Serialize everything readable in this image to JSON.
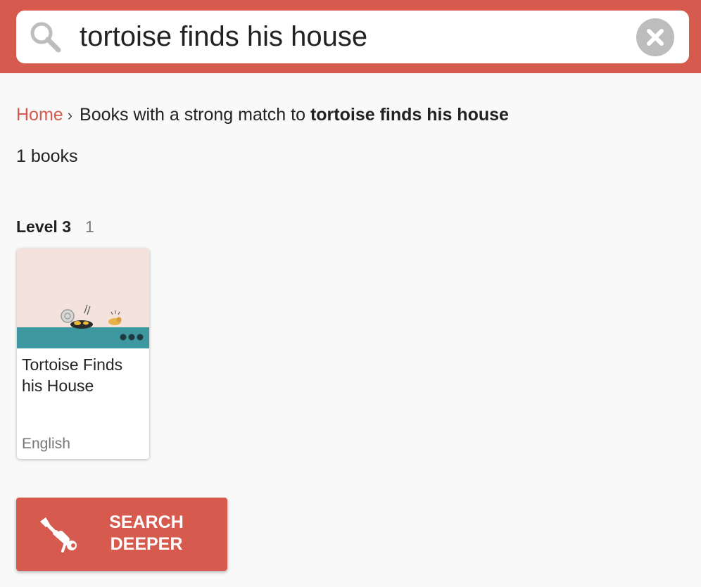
{
  "search": {
    "query": "tortoise finds his house"
  },
  "breadcrumb": {
    "home": "Home",
    "separator": "›",
    "prefix": "Books with a strong match to ",
    "query": "tortoise finds his house"
  },
  "results": {
    "count_text": "1 books"
  },
  "levels": [
    {
      "label": "Level 3",
      "count": "1",
      "books": [
        {
          "title": "Tortoise Finds his House",
          "language": "English",
          "cover_icon": "book-cover-illustration"
        }
      ]
    }
  ],
  "search_deeper": {
    "label": "SEARCH\nDEEPER",
    "icon": "diver-icon"
  },
  "colors": {
    "accent": "#d65a4e",
    "clear_button": "#bdbdbd",
    "cover_background": "#f3e3dc",
    "cover_band": "#3f97a0"
  }
}
